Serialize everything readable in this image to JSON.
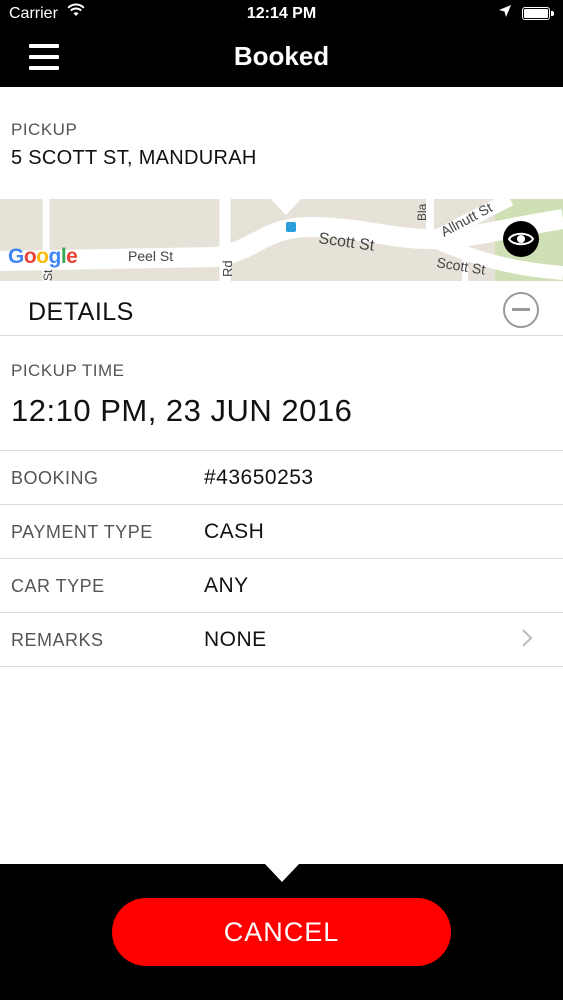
{
  "status_bar": {
    "carrier": "Carrier",
    "time": "12:14 PM"
  },
  "nav": {
    "title": "Booked"
  },
  "pickup": {
    "label": "PICKUP",
    "address": "5 SCOTT ST, MANDURAH"
  },
  "map": {
    "logo": "Google",
    "streets": [
      "Peel St",
      "Scott St",
      "Allnutt St",
      "Scott St",
      "Rd",
      "St",
      "Bla"
    ]
  },
  "details": {
    "label": "DETAILS",
    "pickup_time_label": "PICKUP TIME",
    "pickup_time": "12:10 PM, 23 JUN 2016",
    "rows": [
      {
        "key": "BOOKING",
        "value": "#43650253"
      },
      {
        "key": "PAYMENT TYPE",
        "value": "CASH"
      },
      {
        "key": "CAR TYPE",
        "value": "ANY"
      },
      {
        "key": "REMARKS",
        "value": "NONE"
      }
    ]
  },
  "footer": {
    "cancel_label": "CANCEL"
  },
  "colors": {
    "accent": "#ff0000",
    "bar": "#000000"
  },
  "icons": [
    "menu-icon",
    "wifi-icon",
    "location-arrow-icon",
    "battery-icon",
    "eye-icon",
    "collapse-minus-icon",
    "chevron-right-icon"
  ]
}
